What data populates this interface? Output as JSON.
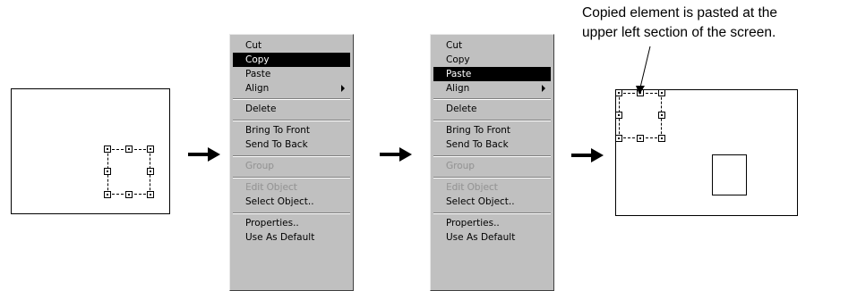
{
  "caption": {
    "line1": "Copied element is pasted at the",
    "line2": "upper left section of the screen."
  },
  "menu_items": [
    "Cut",
    "Copy",
    "Paste",
    "Align",
    "Delete",
    "Bring To Front",
    "Send To Back",
    "Group",
    "Edit Object",
    "Select Object..",
    "Properties..",
    "Use As Default"
  ],
  "menu1": {
    "highlighted": "Copy",
    "disabled": [
      "Group",
      "Edit Object"
    ]
  },
  "menu2": {
    "highlighted": "Paste",
    "disabled": [
      "Group",
      "Edit Object"
    ]
  },
  "icons": {
    "arrow": "right-arrow-icon",
    "submenu": "submenu-arrow-icon"
  },
  "colors": {
    "menu_bg": "#c0c0c0",
    "highlight_bg": "#000000",
    "highlight_fg": "#ffffff"
  }
}
